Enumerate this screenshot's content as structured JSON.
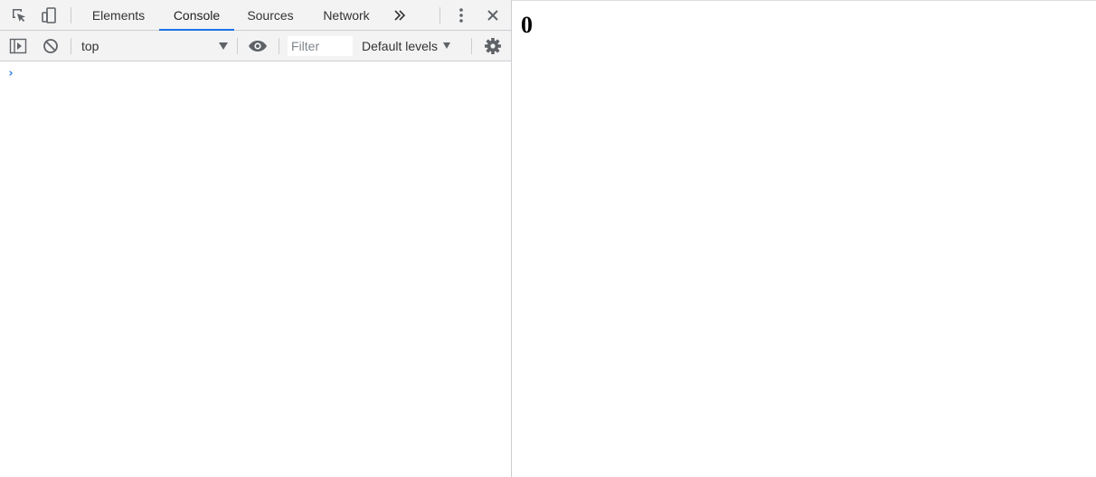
{
  "devtools": {
    "tabs": [
      {
        "label": "Elements",
        "active": false
      },
      {
        "label": "Console",
        "active": true
      },
      {
        "label": "Sources",
        "active": false
      },
      {
        "label": "Network",
        "active": false
      }
    ],
    "icons": {
      "inspect": "inspect-element-icon",
      "device": "device-toolbar-icon",
      "more_tabs": "more-tabs-icon",
      "menu": "kebab-menu-icon",
      "close": "close-icon",
      "sidebar": "console-sidebar-icon",
      "clear": "clear-console-icon",
      "eye": "live-expression-icon",
      "settings": "gear-icon"
    },
    "console_toolbar": {
      "context": "top",
      "filter_placeholder": "Filter",
      "filter_value": "",
      "levels_label": "Default levels"
    },
    "console": {
      "prompt_symbol": "›",
      "input_value": ""
    },
    "colors": {
      "accent": "#1a73e8",
      "toolbar_bg": "#f3f3f3",
      "border": "#cbcdd1",
      "icon": "#5f6368"
    }
  },
  "page": {
    "output_text": "0"
  }
}
